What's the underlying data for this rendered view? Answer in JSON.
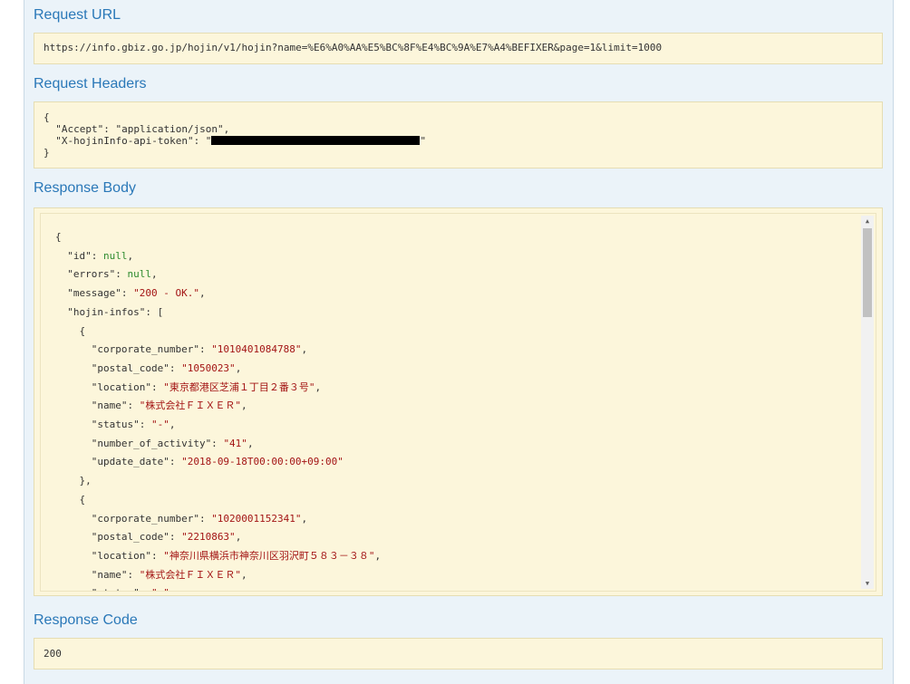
{
  "request_url": {
    "title": "Request URL",
    "value": "https://info.gbiz.go.jp/hojin/v1/hojin?name=%E6%A0%AA%E5%BC%8F%E4%BC%9A%E7%A4%BEFIXER&page=1&limit=1000"
  },
  "request_headers": {
    "title": "Request Headers",
    "open": "{",
    "accept_line": "  \"Accept\": \"application/json\",",
    "token_prefix": "  \"X-hojinInfo-api-token\": \"",
    "token_suffix": "\"",
    "close": "}"
  },
  "response_body": {
    "title": "Response Body",
    "lines": [
      {
        "parts": [
          {
            "t": "k",
            "v": "{"
          }
        ]
      },
      {
        "parts": [
          {
            "t": "k",
            "v": "  \"id\": "
          },
          {
            "t": "n",
            "v": "null"
          },
          {
            "t": "k",
            "v": ","
          }
        ]
      },
      {
        "parts": [
          {
            "t": "k",
            "v": "  \"errors\": "
          },
          {
            "t": "n",
            "v": "null"
          },
          {
            "t": "k",
            "v": ","
          }
        ]
      },
      {
        "parts": [
          {
            "t": "k",
            "v": "  \"message\": "
          },
          {
            "t": "s",
            "v": "\"200 - OK.\""
          },
          {
            "t": "k",
            "v": ","
          }
        ]
      },
      {
        "parts": [
          {
            "t": "k",
            "v": "  \"hojin-infos\": ["
          }
        ]
      },
      {
        "parts": [
          {
            "t": "k",
            "v": "    {"
          }
        ]
      },
      {
        "parts": [
          {
            "t": "k",
            "v": "      \"corporate_number\": "
          },
          {
            "t": "s",
            "v": "\"1010401084788\""
          },
          {
            "t": "k",
            "v": ","
          }
        ]
      },
      {
        "parts": [
          {
            "t": "k",
            "v": "      \"postal_code\": "
          },
          {
            "t": "s",
            "v": "\"1050023\""
          },
          {
            "t": "k",
            "v": ","
          }
        ]
      },
      {
        "parts": [
          {
            "t": "k",
            "v": "      \"location\": "
          },
          {
            "t": "s",
            "v": "\"東京都港区芝浦１丁目２番３号\""
          },
          {
            "t": "k",
            "v": ","
          }
        ]
      },
      {
        "parts": [
          {
            "t": "k",
            "v": "      \"name\": "
          },
          {
            "t": "s",
            "v": "\"株式会社ＦＩＸＥＲ\""
          },
          {
            "t": "k",
            "v": ","
          }
        ]
      },
      {
        "parts": [
          {
            "t": "k",
            "v": "      \"status\": "
          },
          {
            "t": "s",
            "v": "\"-\""
          },
          {
            "t": "k",
            "v": ","
          }
        ]
      },
      {
        "parts": [
          {
            "t": "k",
            "v": "      \"number_of_activity\": "
          },
          {
            "t": "s",
            "v": "\"41\""
          },
          {
            "t": "k",
            "v": ","
          }
        ]
      },
      {
        "parts": [
          {
            "t": "k",
            "v": "      \"update_date\": "
          },
          {
            "t": "s",
            "v": "\"2018-09-18T00:00:00+09:00\""
          }
        ]
      },
      {
        "parts": [
          {
            "t": "k",
            "v": "    },"
          }
        ]
      },
      {
        "parts": [
          {
            "t": "k",
            "v": "    {"
          }
        ]
      },
      {
        "parts": [
          {
            "t": "k",
            "v": "      \"corporate_number\": "
          },
          {
            "t": "s",
            "v": "\"1020001152341\""
          },
          {
            "t": "k",
            "v": ","
          }
        ]
      },
      {
        "parts": [
          {
            "t": "k",
            "v": "      \"postal_code\": "
          },
          {
            "t": "s",
            "v": "\"2210863\""
          },
          {
            "t": "k",
            "v": ","
          }
        ]
      },
      {
        "parts": [
          {
            "t": "k",
            "v": "      \"location\": "
          },
          {
            "t": "s",
            "v": "\"神奈川県横浜市神奈川区羽沢町５８３－３８\""
          },
          {
            "t": "k",
            "v": ","
          }
        ]
      },
      {
        "parts": [
          {
            "t": "k",
            "v": "      \"name\": "
          },
          {
            "t": "s",
            "v": "\"株式会社ＦＩＸＥＲ\""
          },
          {
            "t": "k",
            "v": ","
          }
        ]
      },
      {
        "parts": [
          {
            "t": "k",
            "v": "      \"status\": "
          },
          {
            "t": "s",
            "v": "\"-\""
          },
          {
            "t": "k",
            "v": ","
          }
        ]
      }
    ]
  },
  "response_code": {
    "title": "Response Code",
    "value": "200"
  },
  "icons": {
    "scroll_up": "arrow-up-icon",
    "scroll_down": "arrow-down-icon"
  },
  "colors": {
    "title": "#2a78b8",
    "box_bg": "#fcf6db",
    "json_string": "#a31515",
    "json_null": "#2d8a2d"
  }
}
